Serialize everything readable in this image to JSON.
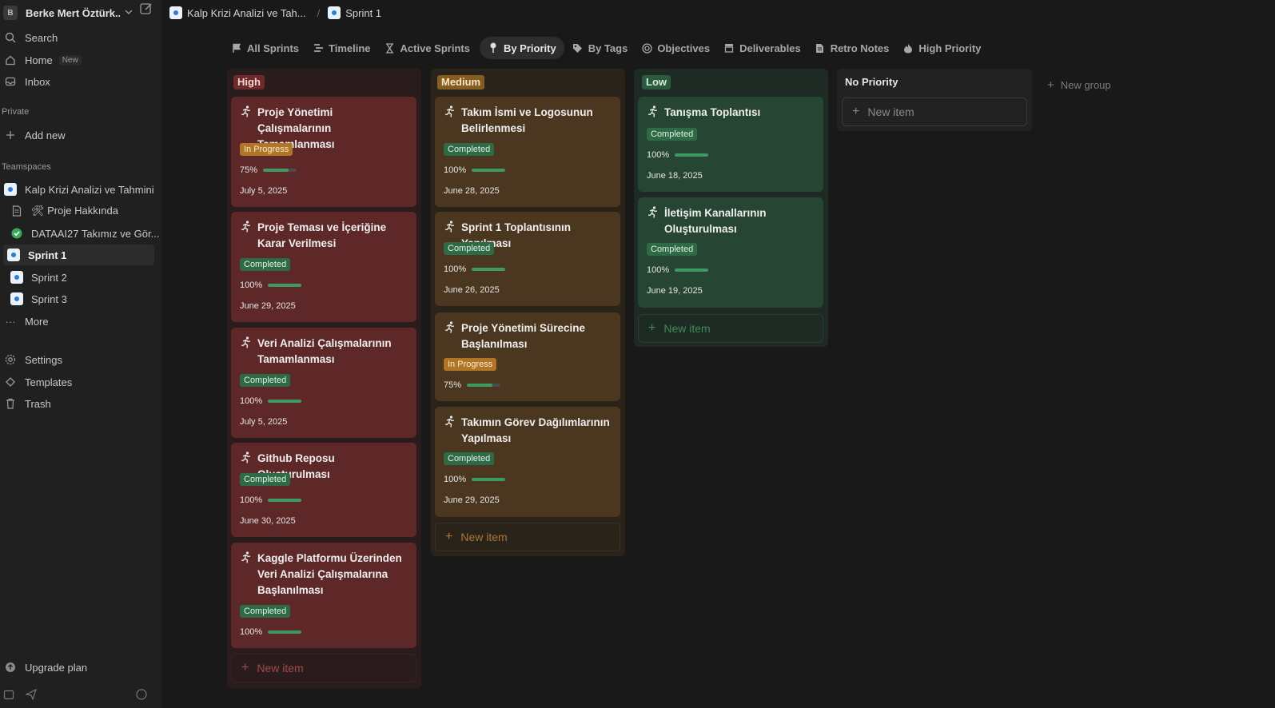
{
  "workspace": {
    "avatar": "B",
    "name": "Berke Mert Öztürk..."
  },
  "sidebar": {
    "search": "Search",
    "home": "Home",
    "home_badge": "New",
    "inbox": "Inbox",
    "private_label": "Private",
    "add_new": "Add new",
    "teamspaces_label": "Teamspaces",
    "teamspace": "Kalp Krizi Analizi ve Tahmini",
    "pages": [
      {
        "label": "🛠 Proje Hakkında"
      },
      {
        "label": "DATAAI27 Takımız ve Gör..."
      },
      {
        "label": "Sprint 1"
      },
      {
        "label": "Sprint 2"
      },
      {
        "label": "Sprint 3"
      }
    ],
    "more": "More",
    "settings": "Settings",
    "templates": "Templates",
    "trash": "Trash",
    "upgrade": "Upgrade plan"
  },
  "breadcrumb": {
    "parent": "Kalp Krizi Analizi ve Tah...",
    "current": "Sprint 1"
  },
  "tabs": [
    {
      "label": "All Sprints",
      "icon": "flag-icon"
    },
    {
      "label": "Timeline",
      "icon": "timeline-icon"
    },
    {
      "label": "Active Sprints",
      "icon": "hourglass-icon"
    },
    {
      "label": "By Priority",
      "icon": "pin-icon",
      "active": true
    },
    {
      "label": "By Tags",
      "icon": "tag-icon"
    },
    {
      "label": "Objectives",
      "icon": "target-icon"
    },
    {
      "label": "Deliverables",
      "icon": "archive-icon"
    },
    {
      "label": "Retro Notes",
      "icon": "document-icon"
    },
    {
      "label": "High Priority",
      "icon": "fire-icon"
    }
  ],
  "board": {
    "groups": [
      {
        "label": "High",
        "color": "#6c2a2a",
        "cards": [
          {
            "title": "Proje Yönetimi Çalışmalarının Tamamlanması",
            "status": "In Progress",
            "progress": 0.75,
            "progress_label": "75%",
            "date": "July 5, 2025"
          },
          {
            "title": "Proje Teması ve İçeriğine Karar Verilmesi",
            "status": "Completed",
            "progress": 1.0,
            "progress_label": "100%",
            "date": "June 29, 2025"
          },
          {
            "title": "Veri Analizi Çalışmalarının Tamamlanması",
            "status": "Completed",
            "progress": 1.0,
            "progress_label": "100%",
            "date": "July 5, 2025"
          },
          {
            "title": "Github Reposu Oluşturulması",
            "status": "Completed",
            "progress": 1.0,
            "progress_label": "100%",
            "date": "June 30, 2025"
          },
          {
            "title": "Kaggle Platformu Üzerinden Veri Analizi Çalışmalarına Başlanılması",
            "status": "Completed",
            "progress": 1.0,
            "progress_label": "100%"
          }
        ]
      },
      {
        "label": "Medium",
        "color": "#855d22",
        "cards": [
          {
            "title": "Takım İsmi ve Logosunun Belirlenmesi",
            "status": "Completed",
            "progress": 1.0,
            "progress_label": "100%",
            "date": "June 28, 2025"
          },
          {
            "title": "Sprint 1 Toplantısının Yapılması",
            "status": "Completed",
            "progress": 1.0,
            "progress_label": "100%",
            "date": "June 26, 2025"
          },
          {
            "title": "Proje Yönetimi Sürecine Başlanılması",
            "status": "In Progress",
            "progress": 0.75,
            "progress_label": "75%"
          },
          {
            "title": "Takımın Görev Dağılımlarının Yapılması",
            "status": "Completed",
            "progress": 1.0,
            "progress_label": "100%",
            "date": "June 29, 2025"
          }
        ]
      },
      {
        "label": "Low",
        "color": "#2c5a3f",
        "cards": [
          {
            "title": "Tanışma Toplantısı",
            "status": "Completed",
            "progress": 1.0,
            "progress_label": "100%",
            "date": "June 18, 2025"
          },
          {
            "title": "İletişim Kanallarının Oluşturulması",
            "status": "Completed",
            "progress": 1.0,
            "progress_label": "100%",
            "date": "June 19, 2025"
          }
        ]
      },
      {
        "label": "No Priority",
        "cards": []
      }
    ],
    "new_item": "New item",
    "new_group": "New group"
  }
}
